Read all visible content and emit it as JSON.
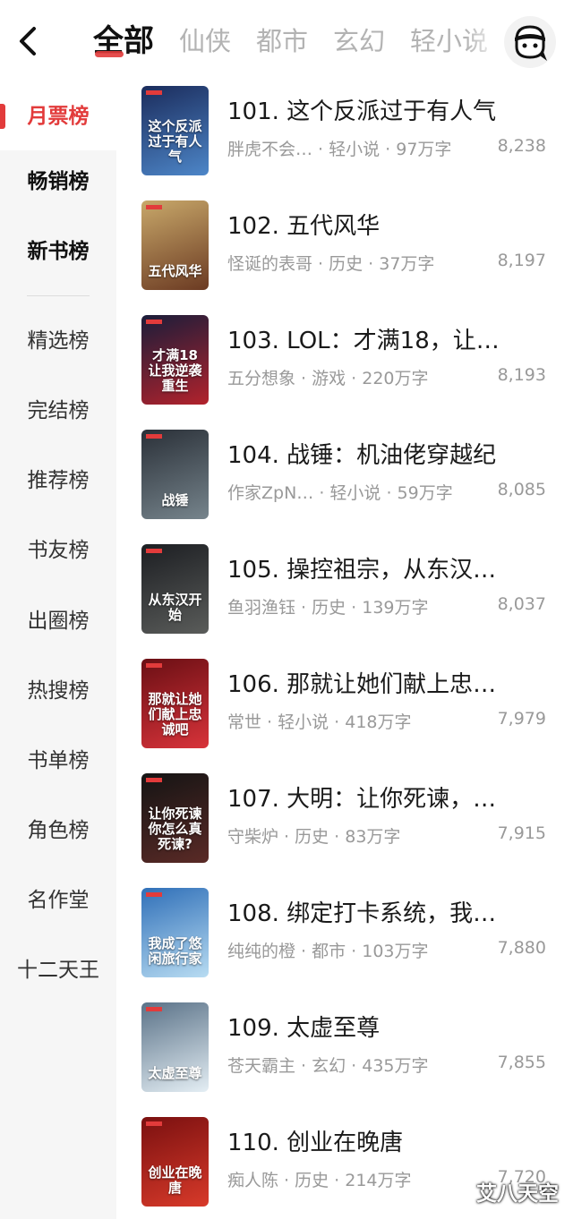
{
  "header": {
    "tabs": [
      "全部",
      "仙侠",
      "都市",
      "玄幻",
      "轻小说"
    ],
    "active_tab": 0
  },
  "sidebar": {
    "items": [
      "月票榜",
      "畅销榜",
      "新书榜",
      "精选榜",
      "完结榜",
      "推荐榜",
      "书友榜",
      "出圈榜",
      "热搜榜",
      "书单榜",
      "角色榜",
      "名作堂",
      "十二天王"
    ]
  },
  "books": [
    {
      "title": "101. 这个反派过于有人气",
      "meta": "胖虎不会… · 轻小说 · 97万字",
      "count": "8,238",
      "cover_text": "这个反派过于有人气",
      "colors": [
        "#1b2c5c",
        "#4d86c8"
      ]
    },
    {
      "title": "102. 五代风华",
      "meta": "怪诞的表哥 · 历史 · 37万字",
      "count": "8,197",
      "cover_text": "五代风华",
      "colors": [
        "#c8a86a",
        "#6b3a22"
      ]
    },
    {
      "title": "103. LOL：才满18，让…",
      "meta": "五分想象 · 游戏 · 220万字",
      "count": "8,193",
      "cover_text": "才满18 让我逆袭重生",
      "colors": [
        "#1a1d3a",
        "#b2222c"
      ]
    },
    {
      "title": "104. 战锤：机油佬穿越纪",
      "meta": "作家ZpN… · 轻小说 · 59万字",
      "count": "8,085",
      "cover_text": "战锤",
      "colors": [
        "#2a3038",
        "#76848c"
      ]
    },
    {
      "title": "105. 操控祖宗，从东汉…",
      "meta": "鱼羽渔钰 · 历史 · 139万字",
      "count": "8,037",
      "cover_text": "从东汉开始",
      "colors": [
        "#1c1e22",
        "#5a5c5a"
      ]
    },
    {
      "title": "106. 那就让她们献上忠…",
      "meta": "常世 · 轻小说 · 418万字",
      "count": "7,979",
      "cover_text": "那就让她们献上忠诚吧",
      "colors": [
        "#6a0f14",
        "#d8333a"
      ]
    },
    {
      "title": "107. 大明：让你死谏，…",
      "meta": "守柴炉 · 历史 · 83万字",
      "count": "7,915",
      "cover_text": "让你死谏 你怎么真死谏?",
      "colors": [
        "#141414",
        "#5a2a26"
      ]
    },
    {
      "title": "108. 绑定打卡系统，我…",
      "meta": "纯纯的橙 · 都市 · 103万字",
      "count": "7,880",
      "cover_text": "我成了悠闲旅行家",
      "colors": [
        "#2f6fb8",
        "#b8dcf2"
      ]
    },
    {
      "title": "109. 太虚至尊",
      "meta": "苍天霸主 · 玄幻 · 435万字",
      "count": "7,855",
      "cover_text": "太虚至尊",
      "colors": [
        "#5a7288",
        "#e4eef4"
      ]
    },
    {
      "title": "110. 创业在晚唐",
      "meta": "痴人陈 · 历史 · 214万字",
      "count": "7,720",
      "cover_text": "创业在晚唐",
      "colors": [
        "#7a1010",
        "#d83a2a"
      ]
    }
  ],
  "watermark": "艾八天空",
  "accent": "#e23b3b",
  "icons": {
    "back": "chevron-left-icon",
    "avatar": "user-avatar-icon"
  }
}
